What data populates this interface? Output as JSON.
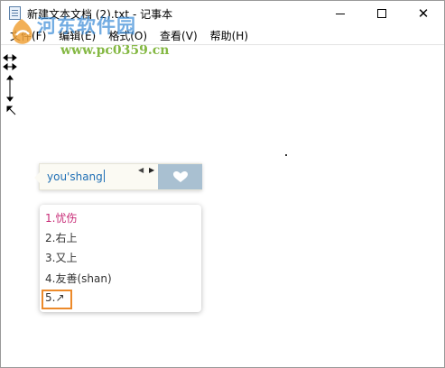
{
  "window": {
    "title": "新建文本文档 (2).txt - 记事本",
    "controls": {
      "minimize_glyph": "—",
      "maximize_glyph": "☐",
      "close_glyph": "✕"
    }
  },
  "menu": {
    "items": [
      "文件(F)",
      "编辑(E)",
      "格式(O)",
      "查看(V)",
      "帮助(H)"
    ]
  },
  "watermark": {
    "name": "河东软件园",
    "url": "www.pc0359.cn",
    "title_color": "#3c8cd7",
    "url_color": "#7ab233"
  },
  "ime": {
    "input": "you'shang",
    "prev_glyph": "◀",
    "next_glyph": "▶",
    "skin_icon": "heart-icon",
    "bar_bg": "#fbfaf3",
    "skin_bg": "#a9c0d1"
  },
  "candidates": {
    "items": [
      "1.忧伤",
      "2.右上",
      "3.又上",
      "4.友善(shan)",
      "5.↗"
    ],
    "active_index": 0,
    "highlight_index": 4,
    "active_color": "#c72a76",
    "highlight_color": "#ec8a2a"
  }
}
